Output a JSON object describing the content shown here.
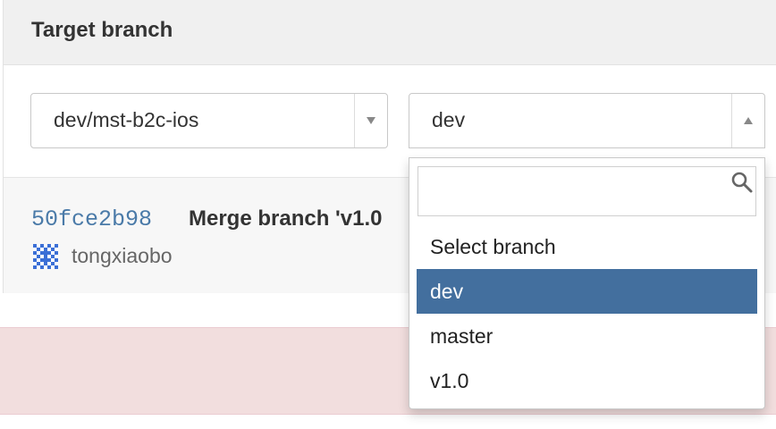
{
  "panel": {
    "title": "Target branch"
  },
  "source_select": {
    "value": "dev/mst-b2c-ios"
  },
  "target_select": {
    "value": "dev"
  },
  "commit": {
    "sha": "50fce2b98",
    "message": "Merge branch 'v1.0",
    "author": "tongxiaobo"
  },
  "dropdown": {
    "search_value": "",
    "items": [
      {
        "label": "Select branch",
        "selected": false
      },
      {
        "label": "dev",
        "selected": true
      },
      {
        "label": "master",
        "selected": false
      },
      {
        "label": "v1.0",
        "selected": false
      }
    ]
  },
  "colors": {
    "link_sha": "#4a7aa8",
    "selected_item_bg": "#436f9e",
    "alert_bg": "#f2dede",
    "header_bg": "#f0f0f0"
  },
  "icons": {
    "source_arrow": "chevron-down-icon",
    "target_arrow": "chevron-up-icon",
    "search": "search-icon",
    "avatar": "identicon-avatar"
  }
}
